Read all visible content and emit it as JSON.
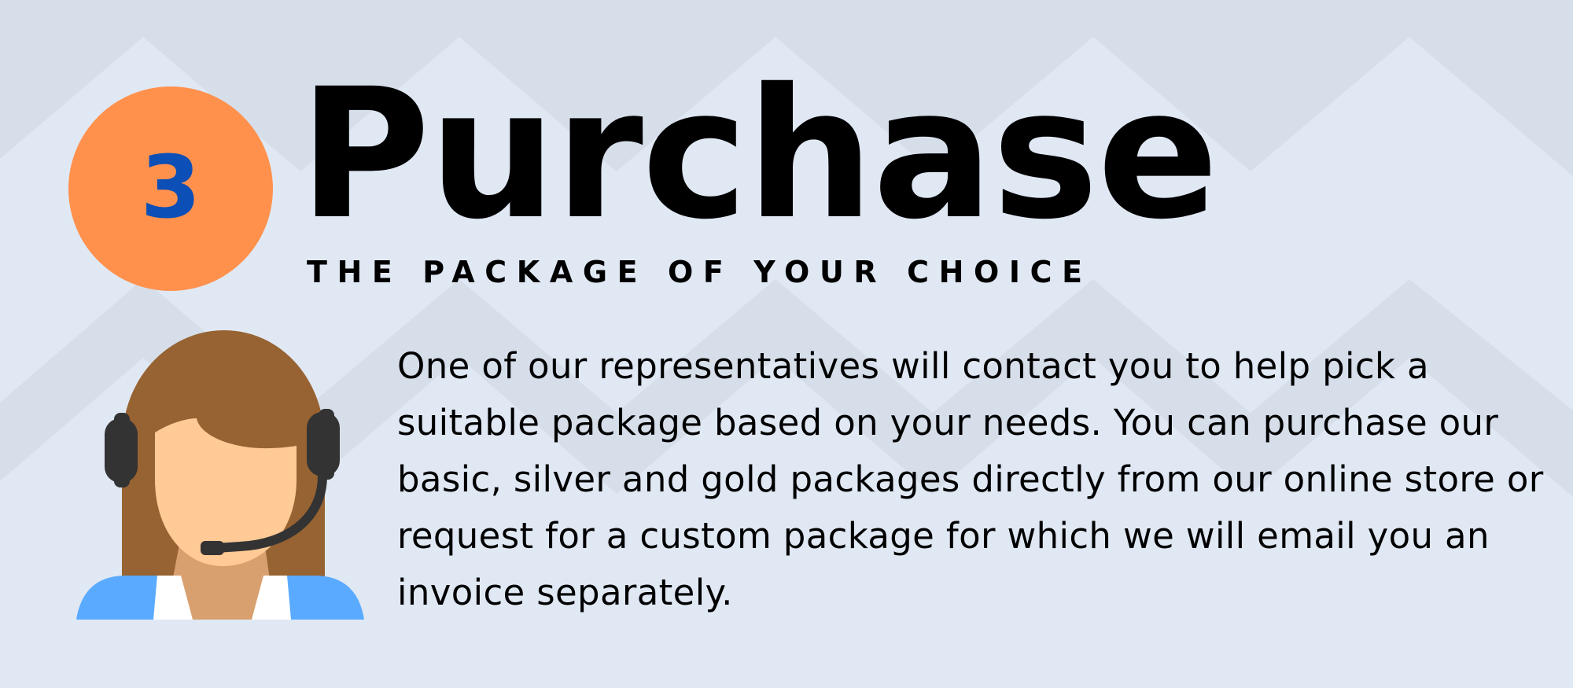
{
  "step": {
    "number": "3",
    "circle_color": "#ff914d",
    "number_color": "#0c4fb6"
  },
  "header": {
    "title": "Purchase",
    "subtitle": "THE PACKAGE OF YOUR CHOICE"
  },
  "avatar": {
    "icon": "customer-support-agent-icon"
  },
  "description": "One of our representatives will contact you to help pick a suitable package based on your needs. You can purchase our basic, silver and gold packages directly from our online store or request for a custom package for which we will email you an invoice separately.",
  "colors": {
    "background": "#d6deea",
    "background_light": "#e0e8f4"
  }
}
